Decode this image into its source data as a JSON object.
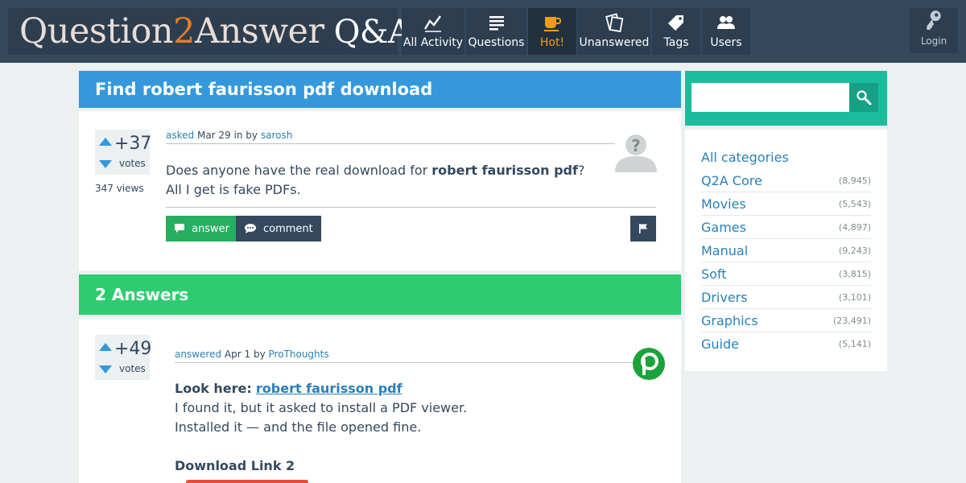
{
  "header": {
    "logo_part1": "Question",
    "logo_two": "2",
    "logo_part2": "Answer",
    "logo_qa": "Q&A",
    "nav": [
      {
        "label": "All Activity",
        "icon": "activity-icon"
      },
      {
        "label": "Questions",
        "icon": "list-icon"
      },
      {
        "label": "Hot!",
        "icon": "coffee-icon"
      },
      {
        "label": "Unanswered",
        "icon": "cards-icon"
      },
      {
        "label": "Tags",
        "icon": "tag-icon"
      },
      {
        "label": "Users",
        "icon": "users-icon"
      }
    ],
    "login_label": "Login"
  },
  "question": {
    "title": "Find robert faurisson pdf download",
    "votes": "+37",
    "votes_label": "votes",
    "views": "347 views",
    "meta_asked": "asked",
    "meta_date": "Mar 29",
    "meta_in_by": "in by",
    "author": "sarosh",
    "text_before": "Does anyone have the real download for ",
    "text_bold": "robert faurisson pdf",
    "text_after": "? All I get is fake PDFs.",
    "answer_btn": "answer",
    "comment_btn": "comment"
  },
  "answers": {
    "heading": "2 Answers",
    "items": [
      {
        "votes": "+49",
        "votes_label": "votes",
        "meta_answered": "answered",
        "meta_date": "Apr 1",
        "meta_by": "by",
        "author": "ProThoughts",
        "look_here": "Look here:",
        "link_text": "robert faurisson pdf",
        "line2": "I found it, but it asked to install a PDF viewer.",
        "line3": "Installed it — and the file opened fine.",
        "download_label": "Download Link 2"
      }
    ]
  },
  "sidebar": {
    "search_placeholder": "",
    "categories": [
      {
        "name": "All categories",
        "count": ""
      },
      {
        "name": "Q2A Core",
        "count": "(8,945)"
      },
      {
        "name": "Movies",
        "count": "(5,543)"
      },
      {
        "name": "Games",
        "count": "(4,897)"
      },
      {
        "name": "Manual",
        "count": "(9,243)"
      },
      {
        "name": "Soft",
        "count": "(3,815)"
      },
      {
        "name": "Drivers",
        "count": "(3,101)"
      },
      {
        "name": "Graphics",
        "count": "(23,491)"
      },
      {
        "name": "Guide",
        "count": "(5,141)"
      }
    ]
  },
  "colors": {
    "header_bg": "#34495e",
    "title_bar": "#3498db",
    "answers_bar": "#2ecc71",
    "hot": "#f39c12",
    "search_bg": "#1abc9c"
  }
}
